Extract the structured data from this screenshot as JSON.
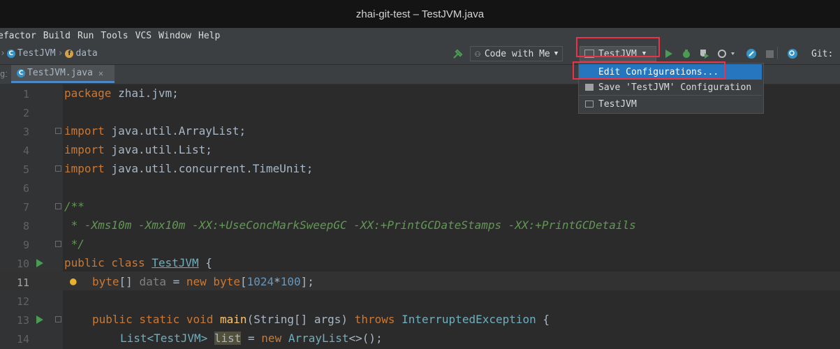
{
  "window": {
    "title": "zhai-git-test – TestJVM.java"
  },
  "menu": [
    "efactor",
    "Build",
    "Run",
    "Tools",
    "VCS",
    "Window",
    "Help"
  ],
  "breadcrumb": {
    "cls": "TestJVM",
    "field": "data"
  },
  "toolbar": {
    "code_with_me": "Code with Me",
    "run_config": "TestJVM",
    "git_label": "Git:"
  },
  "tab": {
    "label": "TestJVM.java",
    "left_fragment": "git"
  },
  "popup": {
    "items": [
      "Edit Configurations...",
      "Save 'TestJVM' Configuration",
      "TestJVM"
    ]
  },
  "code": {
    "line_numbers": [
      "1",
      "2",
      "3",
      "4",
      "5",
      "6",
      "7",
      "8",
      "9",
      "10",
      "11",
      "12",
      "13",
      "14"
    ],
    "l1": {
      "kw": "package",
      "rest": " zhai.jvm;"
    },
    "l3": {
      "kw": "import",
      "rest": " java.util.ArrayList;"
    },
    "l4": {
      "kw": "import",
      "rest": " java.util.List;"
    },
    "l5": {
      "kw": "import",
      "rest": " java.util.concurrent.TimeUnit;"
    },
    "l7": "/**",
    "l8": " * -Xms10m -Xmx10m -XX:+UseConcMarkSweepGC -XX:+PrintGCDateStamps -XX:+PrintGCDetails",
    "l9": " */",
    "l10": {
      "kw": "public class",
      "name": "TestJVM",
      "rest": " {"
    },
    "l11": {
      "kw": "byte",
      "arr": "[] ",
      "field": "data",
      "eq": " = ",
      "kw2": "new",
      "type": " byte",
      "open": "[",
      "n1": "1024",
      "op": "*",
      "n2": "100",
      "close": "];"
    },
    "l13": {
      "kw": "public static void",
      "name": " main",
      "args": "(String[] args) ",
      "kw2": "throws",
      "ex": " InterruptedException",
      "rest": " {"
    },
    "l14": {
      "type": "List",
      "gen": "<TestJVM> ",
      "var": "list",
      "eq": " = ",
      "kw": "new",
      "ctor": " ArrayList",
      "rest": "<>();"
    }
  },
  "colors": {
    "accent": "#4a88c7",
    "highlight_box": "#e8334a",
    "selected": "#2675bf"
  }
}
